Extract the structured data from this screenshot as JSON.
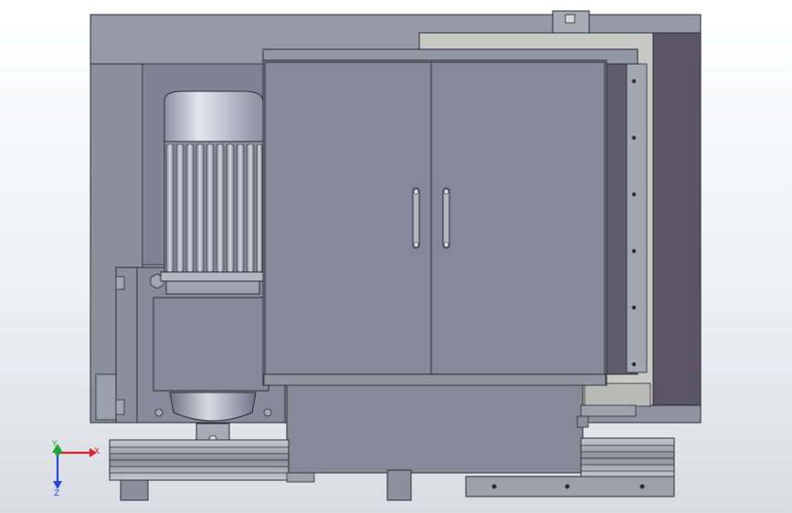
{
  "viewport": {
    "background_top": "#ffffff",
    "background_bottom": "#d9dde3"
  },
  "colors": {
    "frame": "#8d929d",
    "frame_dark": "#6f7480",
    "panel": "#858a99",
    "panel_light": "#9095a3",
    "cabinet": "#868b9a",
    "motor_body": "#9a9eab",
    "motor_fin": "#c4c7d1",
    "motor_fin_dark": "#7d8190",
    "motor_cap": "#b9bccb",
    "side_panel": "#5a5665",
    "light_frame": "#c9cac6",
    "pulley": "#a9acb6",
    "outline": "#2b2d33",
    "axis_x": "#e0202a",
    "axis_y": "#22a83a",
    "axis_z": "#2a46d8"
  },
  "components": [
    "frame",
    "motor",
    "gearbox",
    "electrical-cabinet",
    "cabinet-door-left",
    "cabinet-door-right",
    "side-panel",
    "belt-pulley-left",
    "belt-pulley-right",
    "base-block"
  ],
  "triad": {
    "x_label": "X",
    "y_label": "Y",
    "z_label": "Z"
  }
}
